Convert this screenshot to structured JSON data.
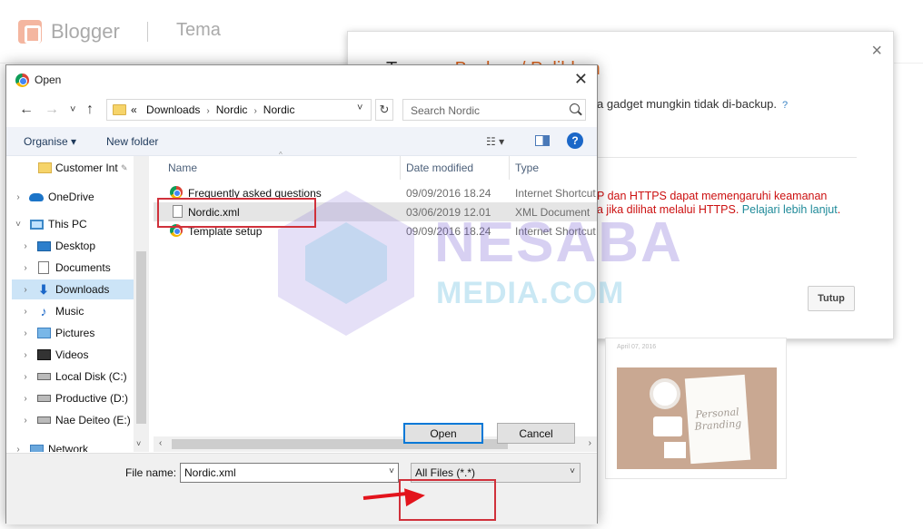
{
  "blogger": {
    "brand": "Blogger",
    "section": "Tema"
  },
  "backup_dialog": {
    "title_crumb": "Tema",
    "title_sep": "›",
    "title_current": "Backup / Pulihkan",
    "close": "×",
    "line1": "a gadget mungkin tidak di-backup.",
    "help": "?",
    "warn1": "P dan HTTPS dapat memengaruhi keamanan",
    "warn2_prefix": "a jika dilihat melalui HTTPS.",
    "warn2_link": "Pelajari lebih lanjut",
    "warn2_suffix": ".",
    "tutup_label": "Tutup",
    "accent_color": "#e0661f"
  },
  "theme_card": {
    "date": "April 07, 2016",
    "paper_text": "Personal Branding"
  },
  "watermark": {
    "text": "NESABA",
    "sub": "MEDIA.COM"
  },
  "open_dialog": {
    "title": "Open",
    "close": "✕",
    "nav": {
      "back": "←",
      "forward": "→",
      "recent": "˅",
      "up": "↑",
      "path_prefix": "«",
      "path": [
        "Downloads",
        "Nordic",
        "Nordic"
      ],
      "path_sep": "›",
      "dropdown": "˅",
      "refresh": "↻",
      "search_placeholder": "Search Nordic"
    },
    "toolbar": {
      "organise": "Organise ▾",
      "new_folder": "New folder",
      "view": "☷ ▾",
      "help": "?"
    },
    "navpane": {
      "items": [
        {
          "label": "Customer Int",
          "icon": "folder-icon",
          "pin": "📌",
          "chevron": ""
        },
        {
          "label": "OneDrive",
          "icon": "cloud-icon",
          "chevron": "›"
        },
        {
          "label": "This PC",
          "icon": "pc-icon",
          "chevron": "˅"
        },
        {
          "label": "Desktop",
          "icon": "desktop-icon",
          "chevron": "›"
        },
        {
          "label": "Documents",
          "icon": "documents-icon",
          "chevron": "›"
        },
        {
          "label": "Downloads",
          "icon": "downloads-icon",
          "chevron": "›",
          "selected": true
        },
        {
          "label": "Music",
          "icon": "music-icon",
          "chevron": "›"
        },
        {
          "label": "Pictures",
          "icon": "pictures-icon",
          "chevron": "›"
        },
        {
          "label": "Videos",
          "icon": "videos-icon",
          "chevron": "›"
        },
        {
          "label": "Local Disk (C:)",
          "icon": "disk-icon",
          "chevron": "›"
        },
        {
          "label": "Productive (D:)",
          "icon": "disk-icon",
          "chevron": "›"
        },
        {
          "label": "Nae Deiteo (E:)",
          "icon": "disk-icon",
          "chevron": "›"
        },
        {
          "label": "Network",
          "icon": "network-icon",
          "chevron": "›"
        }
      ]
    },
    "columns": {
      "name": "Name",
      "date": "Date modified",
      "type": "Type"
    },
    "files": [
      {
        "name": "Frequently asked questions",
        "date": "09/09/2016 18.24",
        "type": "Internet Shortcut",
        "icon": "chrome-icon"
      },
      {
        "name": "Nordic.xml",
        "date": "03/06/2019 12.01",
        "type": "XML Document",
        "icon": "xml-file-icon",
        "selected": true
      },
      {
        "name": "Template setup",
        "date": "09/09/2016 18.24",
        "type": "Internet Shortcut",
        "icon": "chrome-icon"
      }
    ],
    "footer": {
      "file_name_label": "File name:",
      "file_name_value": "Nordic.xml",
      "file_type_value": "All Files (*.*)",
      "open_label": "Open",
      "cancel_label": "Cancel"
    }
  },
  "annotation_color": "#d0313b"
}
